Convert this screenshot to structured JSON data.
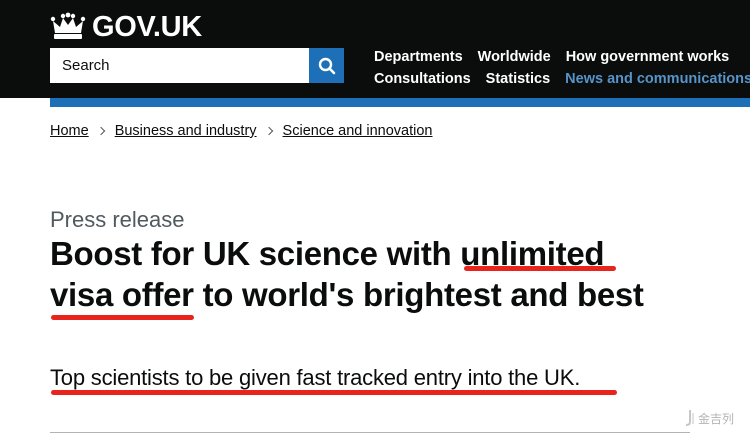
{
  "header": {
    "logo_text": "GOV.UK",
    "search": {
      "placeholder": "Search"
    },
    "nav": {
      "row1": [
        "Departments",
        "Worldwide",
        "How government works"
      ],
      "row2": [
        "Consultations",
        "Statistics",
        "News and communications"
      ]
    }
  },
  "breadcrumb": [
    "Home",
    "Business and industry",
    "Science and innovation"
  ],
  "article": {
    "caption": "Press release",
    "title_line1_a": "Boost for UK science with ",
    "title_line1_b": "unlimited",
    "title_line2_a": "visa offer",
    "title_line2_b": " to world's brightest and best",
    "lead": "Top scientists to be given fast tracked entry into the UK."
  },
  "watermark": {
    "text": "金吉列"
  },
  "colors": {
    "header_bg": "#0b0c0c",
    "brand_blue": "#1d70b8",
    "active_link": "#5694ca",
    "annotation_red": "#e8241c"
  },
  "icons": {
    "logo": "crown-icon",
    "search": "search-icon",
    "breadcrumb_separator": "chevron-right-icon"
  }
}
